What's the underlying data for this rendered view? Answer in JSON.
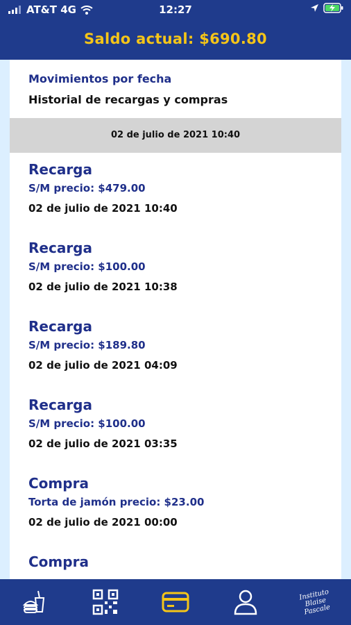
{
  "status_bar": {
    "carrier": "AT&T 4G",
    "time": "12:27"
  },
  "header": {
    "balance_title": "Saldo actual: $690.80"
  },
  "section": {
    "title": "Movimientos por fecha",
    "subtitle": "Historial de recargas y compras"
  },
  "date_group": "02 de julio de 2021 10:40",
  "movements": [
    {
      "type": "Recarga",
      "detail": "S/M precio: $479.00",
      "date": "02 de julio de 2021 10:40"
    },
    {
      "type": "Recarga",
      "detail": "S/M precio: $100.00",
      "date": "02 de julio de 2021 10:38"
    },
    {
      "type": "Recarga",
      "detail": "S/M precio: $189.80",
      "date": "02 de julio de 2021 04:09"
    },
    {
      "type": "Recarga",
      "detail": "S/M precio: $100.00",
      "date": "02 de julio de 2021 03:35"
    },
    {
      "type": "Compra",
      "detail": "Torta de jamón precio: $23.00",
      "date": "02 de julio de 2021 00:00"
    },
    {
      "type": "Compra"
    }
  ],
  "bottom_nav": {
    "items": [
      {
        "icon": "food-icon"
      },
      {
        "icon": "qr-code-icon"
      },
      {
        "icon": "card-icon",
        "active": true
      },
      {
        "icon": "user-icon"
      },
      {
        "icon": "school-logo-icon"
      }
    ],
    "logo_text": "Instituto Blaise Pascale"
  },
  "colors": {
    "primary": "#1f3b8c",
    "accent": "#f5c518",
    "text_blue": "#1f2f8a",
    "side_panel": "#dcefff",
    "date_bar": "#d4d4d4"
  }
}
